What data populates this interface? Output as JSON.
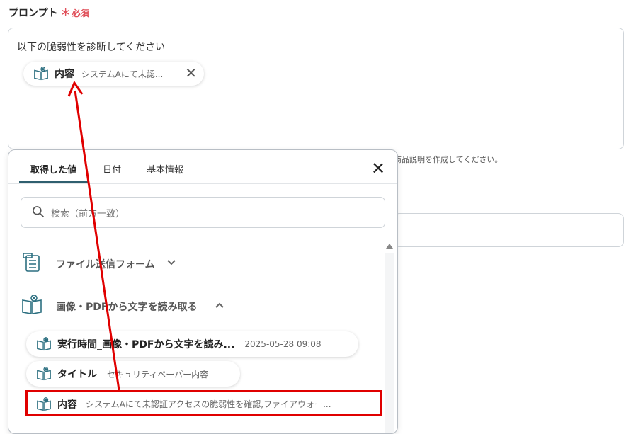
{
  "prompt": {
    "label": "プロンプト",
    "required_star": "＊",
    "required_text": "必須",
    "text": "以下の脆弱性を診断してください",
    "chip": {
      "name": "内容",
      "value": "システムAにて未認..."
    }
  },
  "background": {
    "helper_text": "商品説明を作成してください。"
  },
  "picker": {
    "tabs": [
      "取得した値",
      "日付",
      "基本情報"
    ],
    "search_placeholder": "検索（前方一致）",
    "groups": [
      {
        "label": "ファイル送信フォーム",
        "expanded": false
      },
      {
        "label": "画像・PDFから文字を読み取る",
        "expanded": true
      }
    ],
    "items": [
      {
        "name": "実行時間_画像・PDFから文字を読み...",
        "value": "2025-05-28 09:08"
      },
      {
        "name": "タイトル",
        "value": "セキュリティペーパー内容"
      },
      {
        "name": "内容",
        "value": "システムAにて未認証アクセスの脆弱性を確認,ファイアウォー..."
      }
    ]
  },
  "colors": {
    "accent": "#2f5f6f",
    "required": "#e0505a",
    "annotation": "#e00000",
    "icon": "#2c6f80"
  },
  "icons": [
    "book-open-icon",
    "close-icon",
    "search-icon",
    "form-icon",
    "chevron-down-icon",
    "chevron-up-icon"
  ]
}
